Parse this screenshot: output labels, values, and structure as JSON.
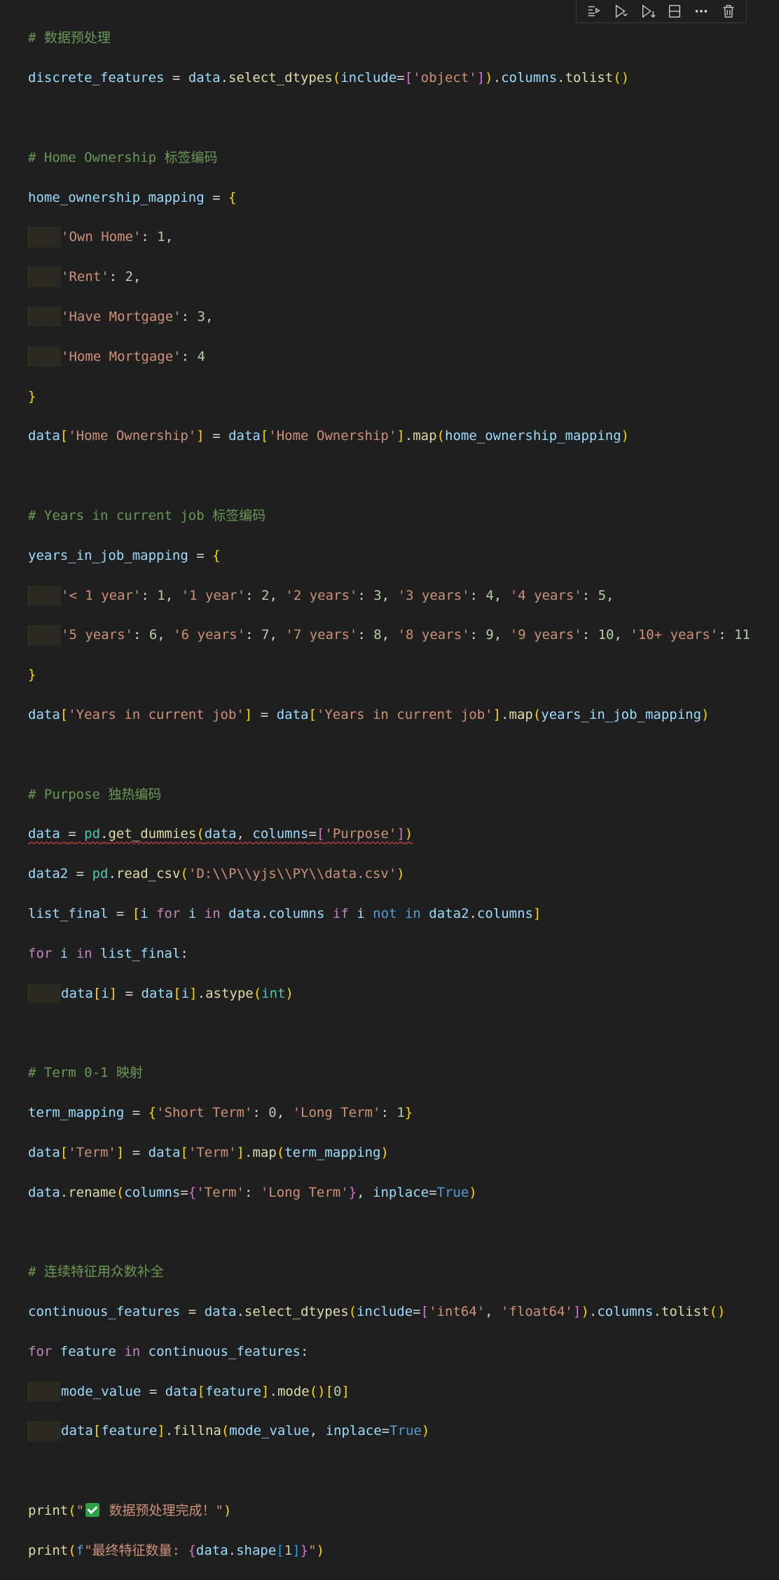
{
  "toolbar": {
    "items": [
      {
        "name": "run-above-icon"
      },
      {
        "name": "run-cell-icon"
      },
      {
        "name": "run-below-icon"
      },
      {
        "name": "split-cell-icon"
      },
      {
        "name": "more-icon"
      },
      {
        "name": "delete-icon"
      }
    ]
  },
  "code": {
    "comments": {
      "c1": "# 数据预处理",
      "c2": "# Home Ownership 标签编码",
      "c3": "# Years in current job 标签编码",
      "c4": "# Purpose 独热编码",
      "c5": "# Term 0-1 映射",
      "c6": "# 连续特征用众数补全"
    },
    "strings": {
      "object": "'object'",
      "own_home": "'Own Home'",
      "rent": "'Rent'",
      "have_mortgage": "'Have Mortgage'",
      "home_mortgage": "'Home Mortgage'",
      "home_ownership": "'Home Ownership'",
      "y_lt1": "'< 1 year'",
      "y1": "'1 year'",
      "y2": "'2 years'",
      "y3": "'3 years'",
      "y4": "'4 years'",
      "y5": "'5 years'",
      "y6": "'6 years'",
      "y7": "'7 years'",
      "y8": "'8 years'",
      "y9": "'9 years'",
      "y10p": "'10+ years'",
      "years_job": "'Years in current job'",
      "purpose": "'Purpose'",
      "csv_path": "'D:\\\\P\\\\yjs\\\\PY\\\\data.csv'",
      "short_term": "'Short Term'",
      "long_term": "'Long Term'",
      "term": "'Term'",
      "int64": "'int64'",
      "float64": "'float64'",
      "done_pre": "\"",
      "done_text": " 数据预处理完成！\"",
      "fstr_prefix": "f",
      "final_count": "\"最终特征数量: ",
      "quote_end": "\""
    },
    "numbers": {
      "n1": "1",
      "n2": "2",
      "n3": "3",
      "n4": "4",
      "n5": "5",
      "n6": "6",
      "n7": "7",
      "n8": "8",
      "n9": "9",
      "n10": "10",
      "n11": "11",
      "n0": "0"
    }
  },
  "colors": {
    "background": "#1f1f1f",
    "comment": "#6a9955",
    "variable": "#9cdcfe",
    "function": "#dcdcaa",
    "string": "#ce9178",
    "number": "#b5cea8",
    "keyword": "#c586c0",
    "builtin": "#569cd6",
    "type": "#4ec9b0",
    "bracket1": "#ffd700",
    "bracket2": "#da70d6",
    "bracket3": "#179fff",
    "error": "#f14c4c"
  }
}
